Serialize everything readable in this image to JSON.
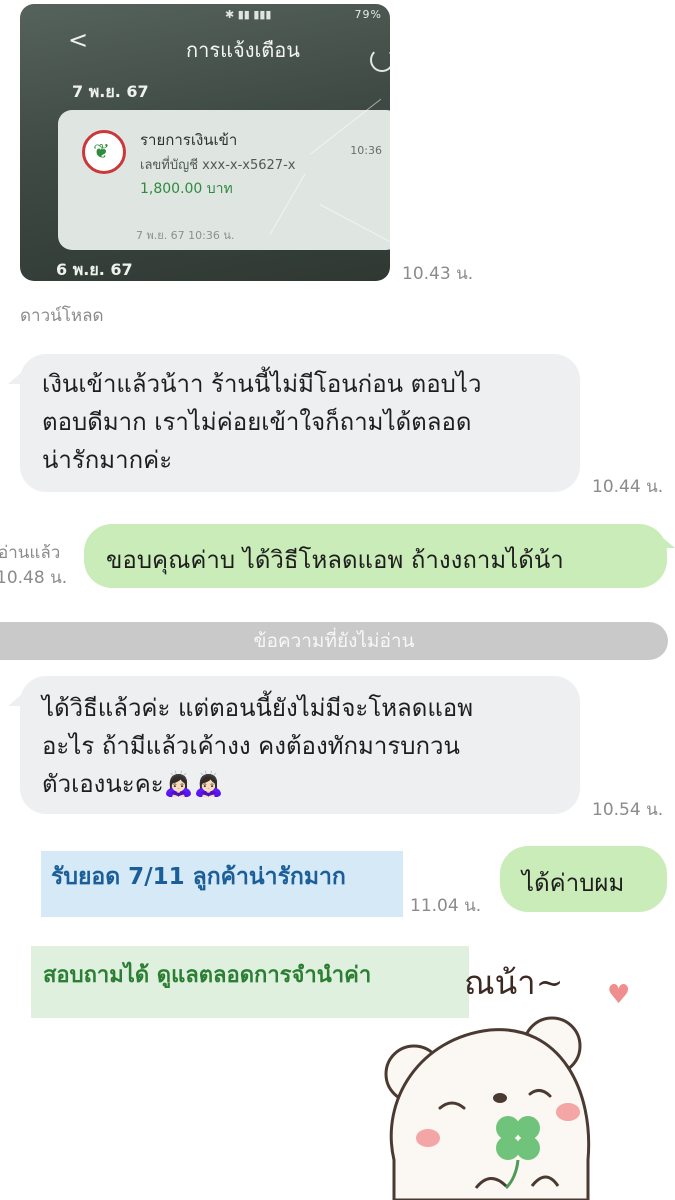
{
  "screenshot": {
    "status_bar": "79%",
    "back_symbol": "<",
    "title": "การแจ้งเตือน",
    "date_top": "7 พ.ย. 67",
    "card": {
      "title": "รายการเงินเข้า",
      "time": "10:36",
      "account": "เลขที่บัญชี xxx-x-x5627-x",
      "amount": "1,800.00 บาท",
      "footer": "7 พ.ย. 67 10:36 น."
    },
    "date_bottom": "6 พ.ย. 67",
    "sent_time": "10.43 น."
  },
  "download_label": "ดาวน์โหลด",
  "messages": {
    "in1": {
      "lines": [
        "เงินเข้าแล้วน้าา ร้านนี้ไม่มีโอนก่อน ตอบไว",
        "ตอบดีมาก เราไม่ค่อยเข้าใจก็ถามได้ตลอด",
        "น่ารักมากค่ะ"
      ],
      "time": "10.44 น."
    },
    "out1": {
      "read_label": "อ่านแล้ว",
      "time": "10.48 น.",
      "text": "ขอบคุณค่าบ ได้วิธีโหลดแอพ ถ้างงถามได้น้า"
    },
    "unread_divider": "ข้อความที่ยังไม่อ่าน",
    "in2": {
      "lines": [
        "ได้วิธีแล้วค่ะ แต่ตอนนี้ยังไม่มีจะโหลดแอพ",
        "อะไร ถ้ามีแล้วเค้างง คงต้องทักมารบกวน",
        "ตัวเองนะคะ"
      ],
      "emoji": "🙇🏻‍♀️🙇🏻‍♀️",
      "time": "10.54 น."
    },
    "out2": {
      "text": "ได้ค่าบผม",
      "time": "11.04 น."
    }
  },
  "overlays": {
    "blue": "รับยอด 7/11 ลูกค้าน่ารักมาก",
    "green": "สอบถามได้ ดูแลตลอดการจำนำค่า"
  },
  "sticker": {
    "text": "ณน้า~",
    "heart": "♥"
  }
}
